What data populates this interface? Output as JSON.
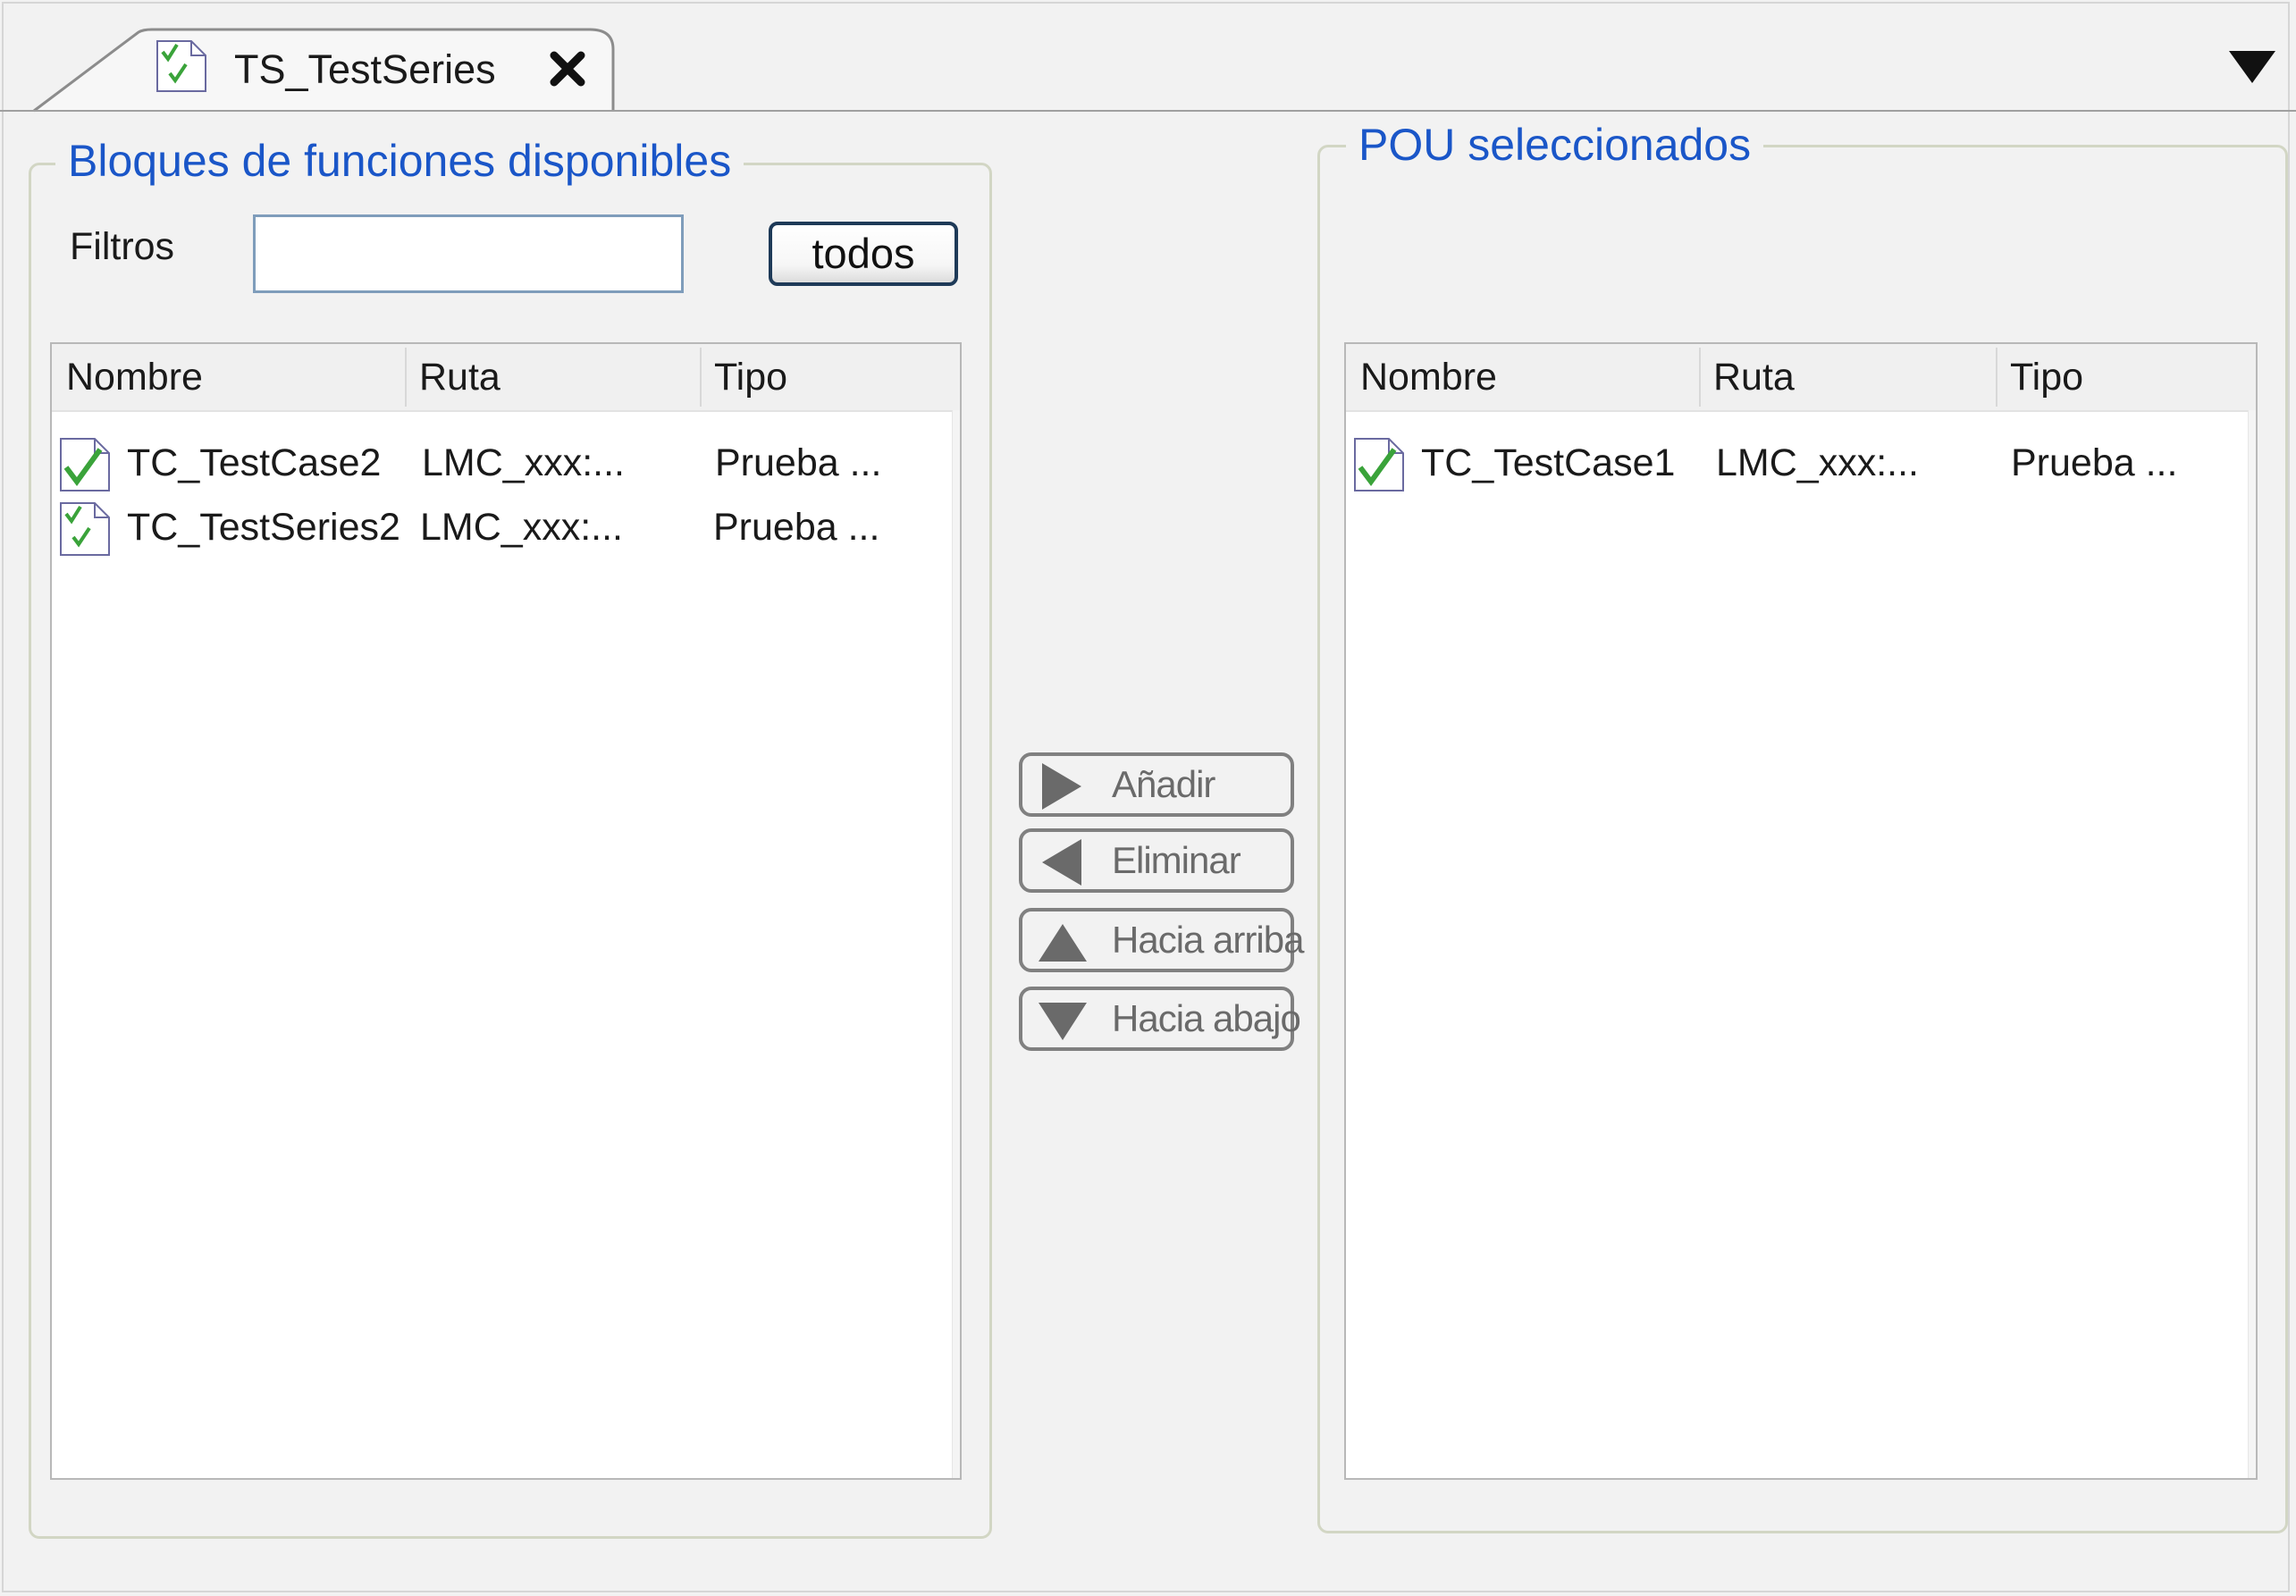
{
  "tab": {
    "title": "TS_TestSeries"
  },
  "available": {
    "title": "Bloques de funciones disponibles",
    "filter_label": "Filtros",
    "filter_value": "",
    "all_button": "todos",
    "columns": [
      "Nombre",
      "Ruta",
      "Tipo"
    ],
    "rows": [
      {
        "icon": "test-case-icon",
        "name": "TC_TestCase2",
        "path": "LMC_xxx:...",
        "type": "Prueba ..."
      },
      {
        "icon": "test-series-icon",
        "name": "TC_TestSeries2",
        "path": "LMC_xxx:...",
        "type": "Prueba ..."
      }
    ]
  },
  "actions": {
    "add": "Añadir",
    "remove": "Eliminar",
    "up": "Hacia arriba",
    "down": "Hacia abajo"
  },
  "selected": {
    "title": "POU seleccionados",
    "columns": [
      "Nombre",
      "Ruta",
      "Tipo"
    ],
    "rows": [
      {
        "icon": "test-case-icon",
        "name": "TC_TestCase1",
        "path": "LMC_xxx:...",
        "type": "Prueba ..."
      }
    ]
  },
  "colors": {
    "accent": "#1a56c8",
    "check": "#3aa33a",
    "border": "#d2d6c4"
  }
}
